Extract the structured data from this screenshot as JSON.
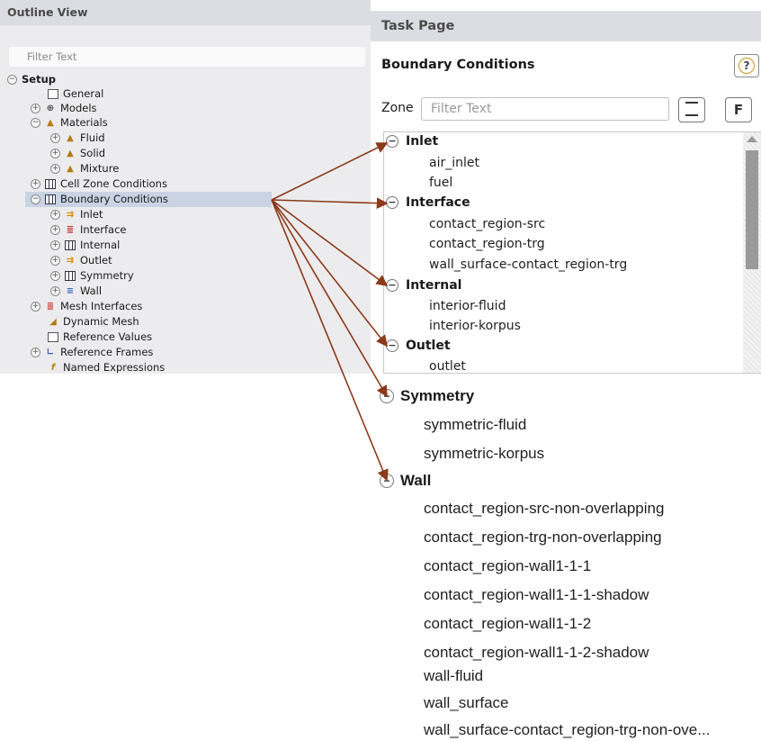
{
  "outline": {
    "title": "Outline View",
    "filter_placeholder": "Filter Text",
    "items": [
      {
        "label": "Setup",
        "toggle": "−",
        "icon": ""
      },
      {
        "label": "General",
        "toggle": "",
        "icon": "general-icon"
      },
      {
        "label": "Models",
        "toggle": "+",
        "icon": "models-icon"
      },
      {
        "label": "Materials",
        "toggle": "−",
        "icon": "materials-icon"
      },
      {
        "label": "Fluid",
        "toggle": "+",
        "icon": "material-fluid-icon"
      },
      {
        "label": "Solid",
        "toggle": "+",
        "icon": "material-solid-icon"
      },
      {
        "label": "Mixture",
        "toggle": "+",
        "icon": "material-mixture-icon"
      },
      {
        "label": "Cell Zone Conditions",
        "toggle": "+",
        "icon": "cell-zone-icon"
      },
      {
        "label": "Boundary Conditions",
        "toggle": "−",
        "icon": "boundary-conditions-icon"
      },
      {
        "label": "Inlet",
        "toggle": "+",
        "icon": "inlet-icon"
      },
      {
        "label": "Interface",
        "toggle": "+",
        "icon": "interface-icon"
      },
      {
        "label": "Internal",
        "toggle": "+",
        "icon": "internal-icon"
      },
      {
        "label": "Outlet",
        "toggle": "+",
        "icon": "outlet-icon"
      },
      {
        "label": "Symmetry",
        "toggle": "+",
        "icon": "symmetry-icon"
      },
      {
        "label": "Wall",
        "toggle": "+",
        "icon": "wall-icon"
      },
      {
        "label": "Mesh Interfaces",
        "toggle": "+",
        "icon": "mesh-interfaces-icon"
      },
      {
        "label": "Dynamic Mesh",
        "toggle": "",
        "icon": "dynamic-mesh-icon"
      },
      {
        "label": "Reference Values",
        "toggle": "",
        "icon": "reference-values-icon"
      },
      {
        "label": "Reference Frames",
        "toggle": "+",
        "icon": "reference-frames-icon"
      },
      {
        "label": "Named Expressions",
        "toggle": "",
        "icon": "named-expressions-icon"
      }
    ]
  },
  "task": {
    "title": "Task Page",
    "section_title": "Boundary Conditions",
    "help_label": "?",
    "zone_label": "Zone",
    "zone_filter_placeholder": "Filter Text",
    "filter_btn_label": "F",
    "groups": [
      {
        "label": "Inlet",
        "items": [
          "air_inlet",
          "fuel"
        ]
      },
      {
        "label": "Interface",
        "items": [
          "contact_region-src",
          "contact_region-trg",
          "wall_surface-contact_region-trg"
        ]
      },
      {
        "label": "Internal",
        "items": [
          "interior-fluid",
          "interior-korpus"
        ]
      },
      {
        "label": "Outlet",
        "items": [
          "outlet"
        ]
      }
    ]
  },
  "expanded": {
    "groups": [
      {
        "label": "Symmetry",
        "items": [
          "symmetric-fluid",
          "symmetric-korpus"
        ]
      },
      {
        "label": "Wall",
        "items": [
          "contact_region-src-non-overlapping",
          "contact_region-trg-non-overlapping",
          "contact_region-wall1-1-1",
          "contact_region-wall1-1-1-shadow",
          "contact_region-wall1-1-2",
          "contact_region-wall1-1-2-shadow",
          "wall-fluid",
          "wall_surface",
          "wall_surface-contact_region-trg-non-ove..."
        ]
      }
    ]
  },
  "colors": {
    "arrow": "#8b3a1a",
    "selected_row": "#c9d3e3",
    "header_bg": "#dcdde2"
  }
}
